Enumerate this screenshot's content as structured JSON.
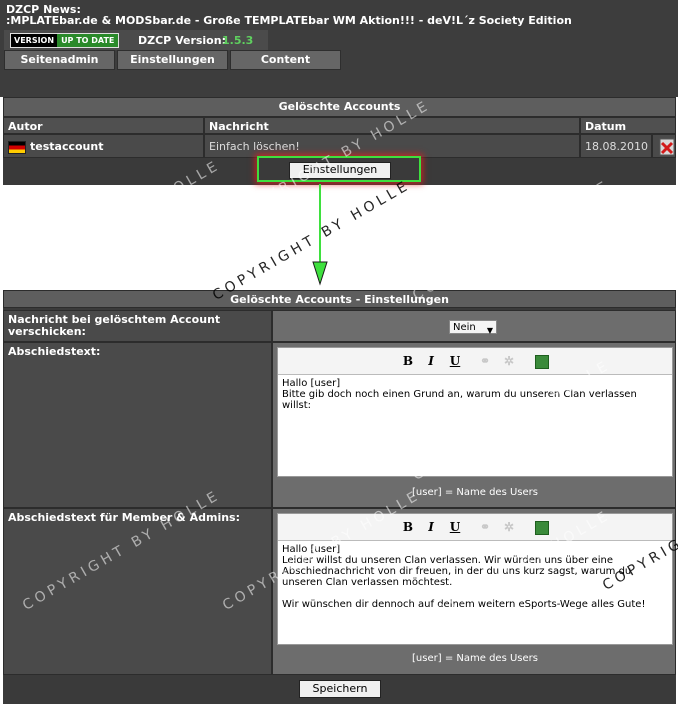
{
  "header": {
    "news_title": "DZCP News:",
    "news_text": ":MPLATEbar.de & MODSbar.de - Große TEMPLATEbar WM Aktion!!! - deV!L´z Society Edition",
    "version_badge_left": "VERSION",
    "version_badge_right": "UP TO DATE",
    "dzcp_version_label": "DZCP Version:",
    "dzcp_version_value": "1.5.3"
  },
  "nav": [
    {
      "label": "Seitenadmin"
    },
    {
      "label": "Einstellungen"
    },
    {
      "label": "Content"
    }
  ],
  "deleted_accounts": {
    "title": "Gelöschte Accounts",
    "columns": [
      "Autor",
      "Nachricht",
      "Datum"
    ],
    "rows": [
      {
        "author": "testaccount",
        "message": "Einfach löschen!",
        "date": "18.08.2010"
      }
    ],
    "settings_button": "Einstellungen"
  },
  "settings": {
    "title": "Gelöschte Accounts - Einstellungen",
    "send_message_label": "Nachricht bei gelöschtem Account verschicken:",
    "send_message_value": "Nein",
    "farewell_label": "Abschiedstext:",
    "farewell_text": "Hallo [user]\nBitte gib doch noch einen Grund an, warum du unseren Clan verlassen willst:",
    "farewell_hint": "[user] = Name des Users",
    "farewell_members_label": "Abschiedstext für Member & Admins:",
    "farewell_members_text": "Hallo [user]\nLeider willst du unseren Clan verlassen. Wir würden uns über eine Abschiednachricht von dir freuen, in der du uns kurz sagst, warum du unseren Clan verlassen möchtest.\n\nWir wünschen dir dennoch auf deinem weitern eSports-Wege alles Gute!",
    "farewell_members_hint": "[user] = Name des Users",
    "toolbar": {
      "bold": "B",
      "italic": "I",
      "underline": "U"
    },
    "save_button": "Speichern"
  },
  "watermark": "COPYRIGHT BY HOLLE",
  "icons": [
    "flag-icon",
    "delete-icon",
    "dropdown-caret-icon",
    "image-insert-icon",
    "link-icon",
    "unlink-icon"
  ],
  "colors": {
    "accent_green": "#3ee03e",
    "highlight_red": "#dc1e1e",
    "version_green": "#5fd05f"
  }
}
